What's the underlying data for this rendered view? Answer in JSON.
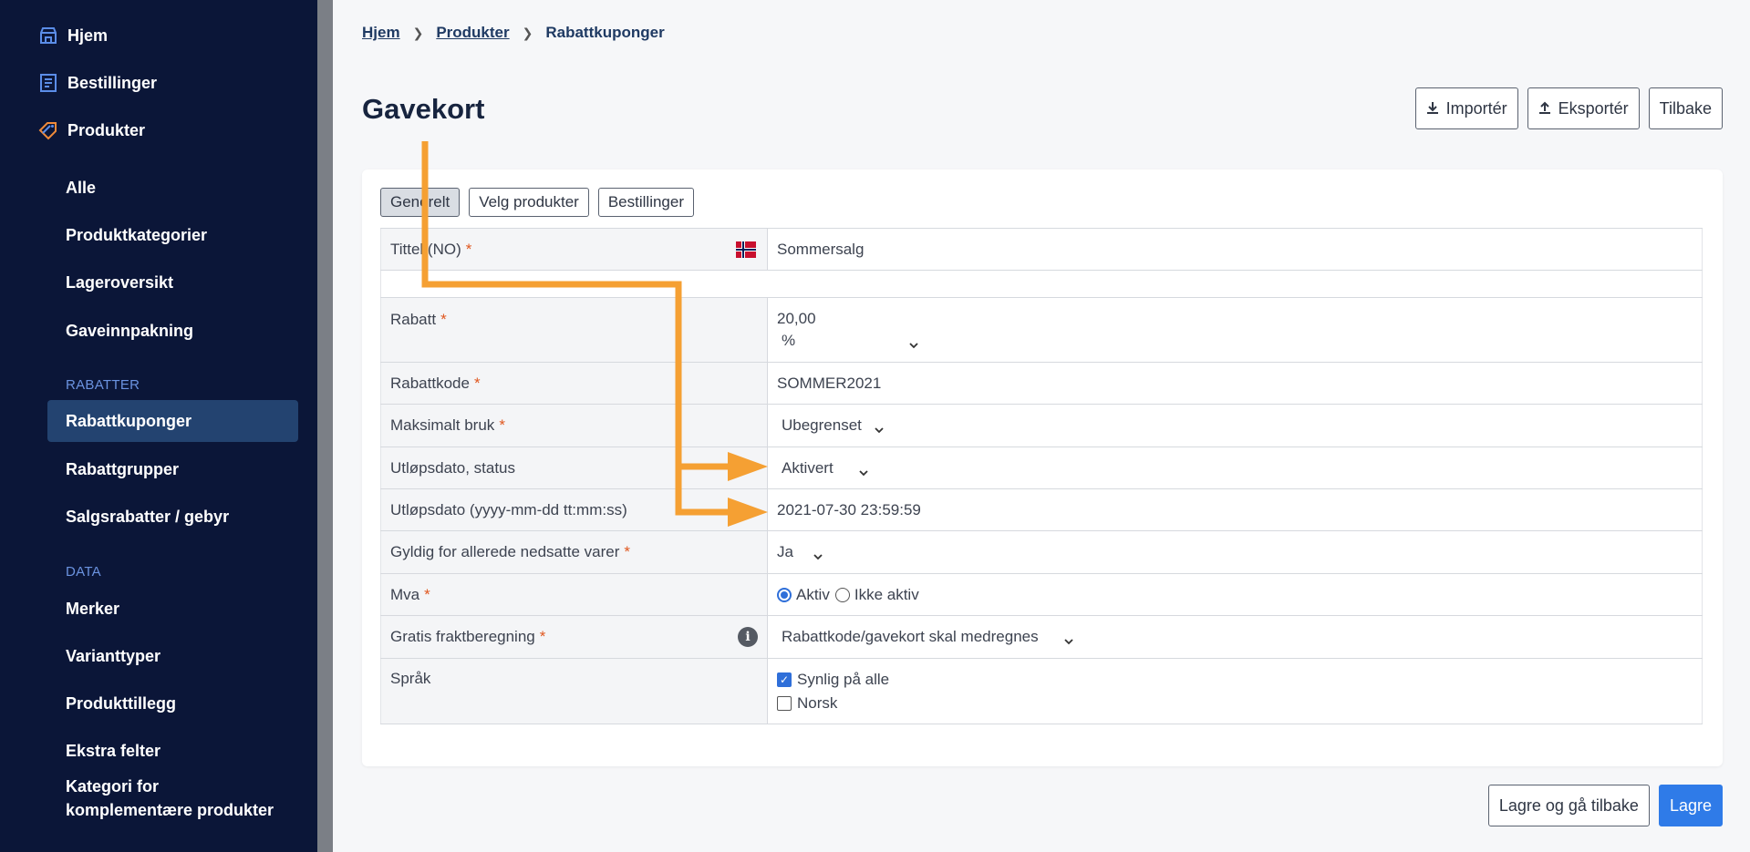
{
  "sidebar": {
    "top_items": [
      {
        "label": "Hjem",
        "icon": "store-icon"
      },
      {
        "label": "Bestillinger",
        "icon": "orders-icon"
      },
      {
        "label": "Produkter",
        "icon": "tag-icon"
      }
    ],
    "products_sub": [
      "Alle",
      "Produktkategorier",
      "Lageroversikt",
      "Gaveinnpakning"
    ],
    "section_discounts": "RABATTER",
    "discounts_sub": [
      "Rabattkuponger",
      "Rabattgrupper",
      "Salgsrabatter / gebyr"
    ],
    "section_data": "DATA",
    "data_sub": [
      "Merker",
      "Varianttyper",
      "Produkttillegg",
      "Ekstra felter",
      "Kategori for",
      "komplementære produkter"
    ]
  },
  "breadcrumb": {
    "home": "Hjem",
    "products": "Produkter",
    "current": "Rabattkuponger"
  },
  "page_title": "Gavekort",
  "top_actions": {
    "import": "Importér",
    "export": "Eksportér",
    "back": "Tilbake"
  },
  "tabs": [
    "Generelt",
    "Velg produkter",
    "Bestillinger"
  ],
  "form": {
    "title_label": "Tittel (NO)",
    "title_value": "Sommersalg",
    "discount_label": "Rabatt",
    "discount_value": "20,00",
    "discount_unit": "%",
    "code_label": "Rabattkode",
    "code_value": "SOMMER2021",
    "max_use_label": "Maksimalt bruk",
    "max_use_value": "Ubegrenset",
    "expiry_status_label": "Utløpsdato, status",
    "expiry_status_value": "Aktivert",
    "expiry_date_label": "Utløpsdato (yyyy-mm-dd tt:mm:ss)",
    "expiry_date_value": "2021-07-30 23:59:59",
    "valid_discounted_label": "Gyldig for allerede nedsatte varer",
    "valid_discounted_value": "Ja",
    "vat_label": "Mva",
    "vat_active": "Aktiv",
    "vat_inactive": "Ikke aktiv",
    "free_shipping_label": "Gratis fraktberegning",
    "free_shipping_value": "Rabattkode/gavekort skal medregnes",
    "language_label": "Språk",
    "language_all": "Synlig på alle",
    "language_norsk": "Norsk",
    "required_mark": "*"
  },
  "bottom_actions": {
    "save_back": "Lagre og gå tilbake",
    "save": "Lagre"
  },
  "colors": {
    "sidebar": "#0b1638",
    "active_nav": "#234370",
    "accent": "#2f7be8",
    "arrow": "#f5a033",
    "required": "#e0571f"
  }
}
